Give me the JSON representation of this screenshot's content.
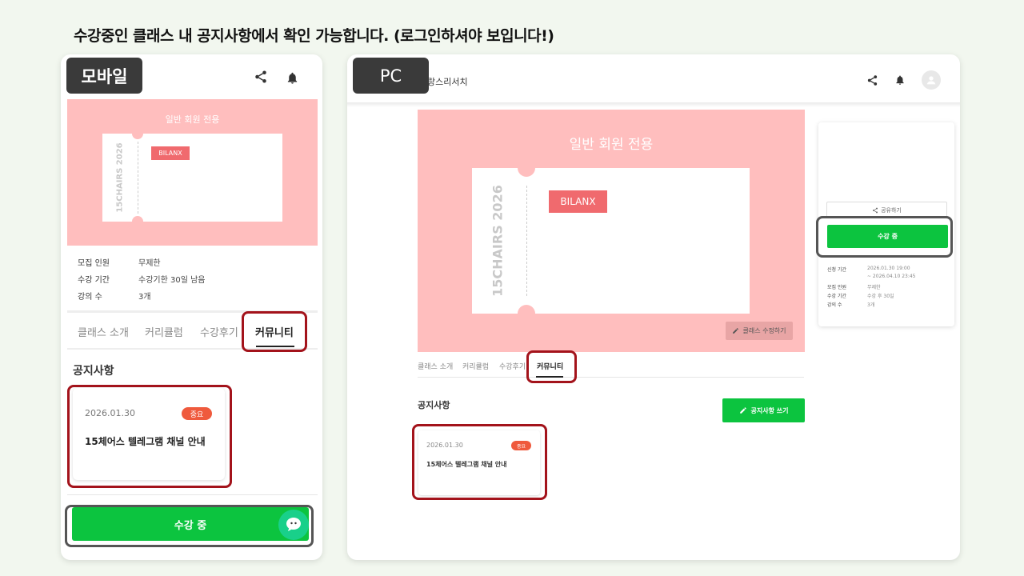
{
  "headline": "수강중인 클래스 내 공지사항에서 확인 가능합니다. (로그인하셔야 보입니다!)",
  "colors": {
    "accent_green": "#0cc43f",
    "banner_pink": "#ffbebe",
    "brand_red": "#f06a6e",
    "badge_orange": "#ef5a3d",
    "highlight_red": "#a3131b"
  },
  "mobile": {
    "tag": "모바일",
    "icons": [
      "share-icon",
      "bell-icon"
    ],
    "banner": {
      "title": "일반 회원 전용",
      "vertical_text": "15CHAIRS 2026",
      "brand": "BILANX"
    },
    "info": [
      {
        "label": "모집 인원",
        "value": "무제한"
      },
      {
        "label": "수강 기간",
        "value": "수강기한 30일 남음"
      },
      {
        "label": "강의 수",
        "value": "3개"
      }
    ],
    "tabs": [
      "클래스 소개",
      "커리큘럼",
      "수강후기",
      "커뮤니티"
    ],
    "active_tab": "커뮤니티",
    "section_title": "공지사항",
    "notice": {
      "date": "2026.01.30",
      "badge": "중요",
      "title": "15체어스 텔레그램 채널 안내"
    },
    "enroll_button": "수강 중"
  },
  "pc": {
    "tag": "PC",
    "site_title": "랑스리서치",
    "icons": [
      "share-icon",
      "bell-icon",
      "avatar-icon"
    ],
    "banner": {
      "title": "일반 회원 전용",
      "vertical_text": "15CHAIRS 2026",
      "brand": "BILANX",
      "edit_button": "클래스 수정하기"
    },
    "tabs": [
      "클래스 소개",
      "커리큘럼",
      "수강후기",
      "커뮤니티"
    ],
    "active_tab": "커뮤니티",
    "section_title": "공지사항",
    "write_button": "공지사항 쓰기",
    "notice": {
      "date": "2026.01.30",
      "badge": "중요",
      "title": "15체어스 텔레그램 채널 안내"
    },
    "side": {
      "share_button": "공유하기",
      "enroll_button": "수강 중",
      "info": [
        {
          "label": "신청 기간",
          "value": "2026.01.30 19:00",
          "value2": "~ 2026.04.10 23:45"
        },
        {
          "label": "모집 인원",
          "value": "무제한"
        },
        {
          "label": "수강 기간",
          "value": "수강 후 30일"
        },
        {
          "label": "강의 수",
          "value": "3개"
        }
      ]
    }
  }
}
